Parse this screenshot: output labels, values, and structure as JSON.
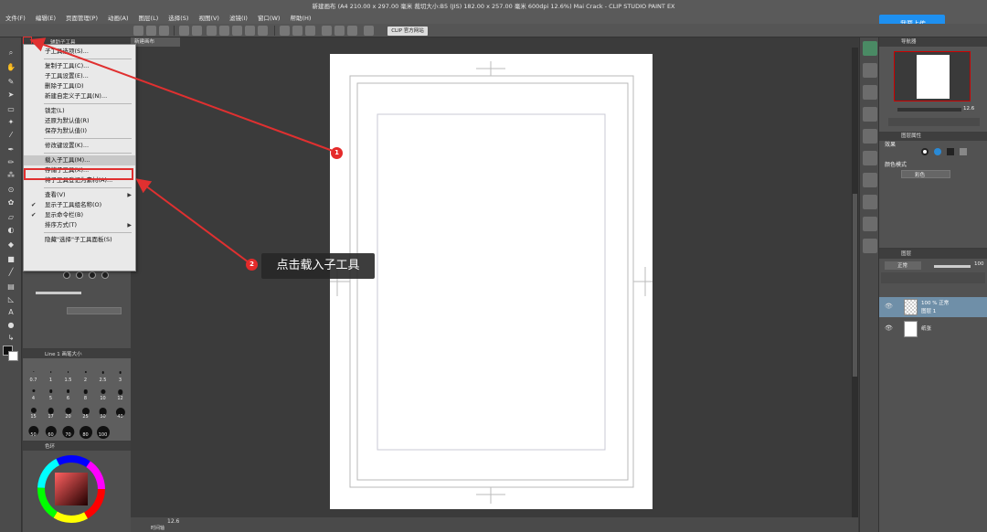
{
  "window": {
    "title": "新建画布 (A4 210.00 x 297.00 毫米 裁切大小:B5 (JIS) 182.00 x 257.00 毫米 600dpi 12.6%)   Mai Crack - CLIP STUDIO PAINT EX"
  },
  "menubar": {
    "items": [
      "文件(F)",
      "编辑(E)",
      "页面管理(P)",
      "动画(A)",
      "图层(L)",
      "选择(S)",
      "视图(V)",
      "滤镜(I)",
      "窗口(W)",
      "帮助(H)"
    ]
  },
  "share_button": {
    "label": "我要上传"
  },
  "toolbar": {
    "clip_label": "CLIP 官方网站"
  },
  "subtool_panel": {
    "tab": "辅助子工具"
  },
  "canvas": {
    "tab": "新建画布",
    "zoom": "12.6",
    "status_tab": "时间轴"
  },
  "dropdown": {
    "items": [
      {
        "label": "子工具选项(S)...",
        "checked": false,
        "submenu": false
      },
      {
        "sep": true
      },
      {
        "label": "复制子工具(C)...",
        "checked": false,
        "submenu": false
      },
      {
        "label": "子工具设置(E)...",
        "checked": false,
        "submenu": false
      },
      {
        "label": "删除子工具(D)",
        "checked": false,
        "submenu": false
      },
      {
        "label": "新建自定义子工具(N)...",
        "checked": false,
        "submenu": false
      },
      {
        "sep": true
      },
      {
        "label": "锁定(L)",
        "checked": false,
        "submenu": false
      },
      {
        "label": "还原为默认值(R)",
        "checked": false,
        "submenu": false
      },
      {
        "label": "保存为默认值(I)",
        "checked": false,
        "submenu": false
      },
      {
        "sep": true
      },
      {
        "label": "修改键设置(K)...",
        "checked": false,
        "submenu": false
      },
      {
        "sep": true
      },
      {
        "label": "载入子工具(M)...",
        "checked": false,
        "submenu": false,
        "highlight": true
      },
      {
        "label": "存储子工具(X)...",
        "checked": false,
        "submenu": false
      },
      {
        "label": "将子工具登记为素材(A)...",
        "checked": false,
        "submenu": false
      },
      {
        "sep": true
      },
      {
        "label": "查看(V)",
        "checked": false,
        "submenu": true
      },
      {
        "label": "显示子工具组名称(O)",
        "checked": true,
        "submenu": false
      },
      {
        "label": "显示命令栏(B)",
        "checked": true,
        "submenu": false
      },
      {
        "label": "排序方式(T)",
        "checked": false,
        "submenu": true
      },
      {
        "sep": true
      },
      {
        "label": "隐藏\"选择\"子工具面板(S)",
        "checked": false,
        "submenu": false
      }
    ]
  },
  "brush_size": {
    "tab": "Line 1 画笔大小",
    "sizes": [
      "0.7",
      "1",
      "1.5",
      "2",
      "2.5",
      "3",
      "4",
      "5",
      "6",
      "8",
      "10",
      "12",
      "15",
      "17",
      "20",
      "25",
      "30",
      "40",
      "50",
      "60",
      "70",
      "80",
      "100"
    ]
  },
  "color_panel": {
    "tab": "色环"
  },
  "navigator": {
    "tab": "导航器",
    "zoom": "12.6"
  },
  "properties": {
    "tab": "图层属性",
    "effect_label": "效果",
    "color_mode_label": "颜色模式",
    "color_mode_value": "彩色"
  },
  "layers": {
    "tab": "图层",
    "blend_mode": "正常",
    "opacity": "100",
    "rows": [
      {
        "line1": "100 % 正常",
        "line2": "图层 1",
        "selected": true
      },
      {
        "line1": "",
        "line2": "纸张",
        "selected": false
      }
    ]
  },
  "annotation": {
    "callout_text": "点击载入子工具",
    "step1": "1",
    "step2": "2",
    "accent_color": "#e03030"
  }
}
